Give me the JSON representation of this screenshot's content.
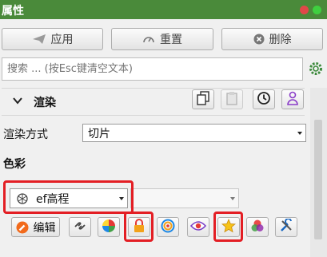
{
  "panel": {
    "title": "属性"
  },
  "toolbar": {
    "apply_label": "应用",
    "reset_label": "重置",
    "delete_label": "删除"
  },
  "search": {
    "placeholder": "搜索 ... (按Esc键清空文本)"
  },
  "section": {
    "render_title": "渲染"
  },
  "render": {
    "mode_label": "渲染方式",
    "mode_value": "切片",
    "color_heading": "色彩",
    "ramp_value": "ef高程",
    "edit_label": "编辑"
  },
  "colors": {
    "titlebar": "#4a8a3a",
    "highlight": "#e31e24",
    "dot_red": "#e04848",
    "dot_green": "#3fcf3f"
  },
  "icons": [
    "send-icon",
    "gauge-icon",
    "close-circle-icon",
    "settings-icon",
    "chevron-down-icon",
    "copy-icon",
    "paste-icon",
    "history-icon",
    "user-icon",
    "ramp-icon",
    "edit-icon",
    "link-broken-icon",
    "color-wheel-icon",
    "lock-icon",
    "target-icon",
    "eye-icon",
    "star-icon",
    "rgb-icon",
    "tools-icon"
  ]
}
